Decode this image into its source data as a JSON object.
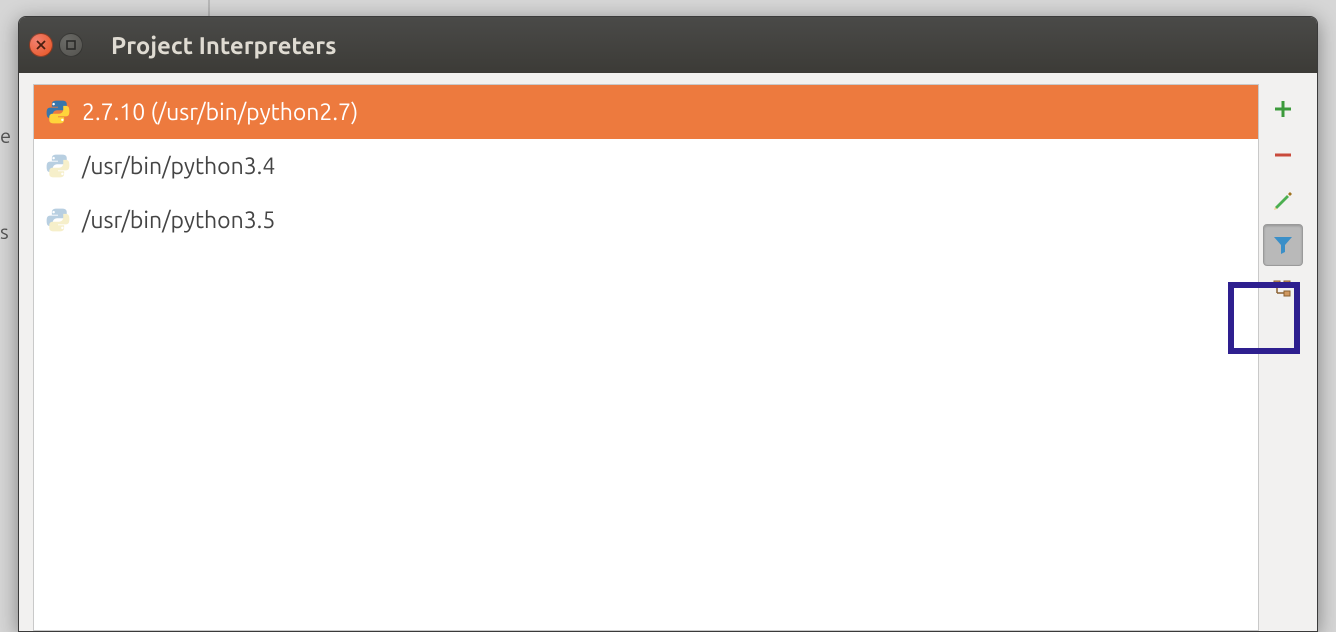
{
  "window": {
    "title": "Project Interpreters"
  },
  "interpreters": [
    {
      "label": "2.7.10 (/usr/bin/python2.7)",
      "selected": true,
      "active": true
    },
    {
      "label": "/usr/bin/python3.4",
      "selected": false,
      "active": false
    },
    {
      "label": "/usr/bin/python3.5",
      "selected": false,
      "active": false
    }
  ],
  "toolbar": {
    "add": "Add",
    "remove": "Remove",
    "edit": "Edit",
    "filter": "Filter",
    "paths": "Show paths"
  },
  "backdrop": {
    "e": "e",
    "s": "s"
  }
}
